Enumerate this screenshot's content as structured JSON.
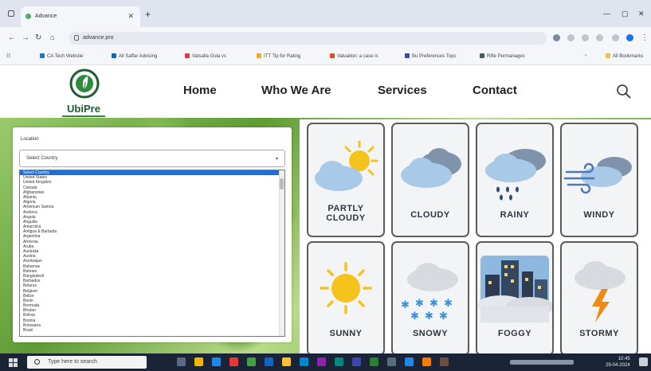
{
  "browser": {
    "tab_title": "Advance",
    "address": "advance.pro",
    "bookmarks": [
      "CA Tech Website",
      "All Saffar Advising",
      "Vatsalla Gola vs",
      "ITT Tip for Rating",
      "Valuation: a case is",
      "Bu Preferences Topc",
      "Rifle Permanages",
      "All Bookmarks"
    ]
  },
  "site": {
    "logo_text": "UbiPre",
    "nav": [
      "Home",
      "Who We Are",
      "Services",
      "Contact"
    ]
  },
  "country_panel": {
    "label": "Location",
    "select_placeholder": "Select Country",
    "options": [
      "Select Country",
      "United States",
      "United Kingdom",
      "Canada",
      "Afghanistan",
      "Albania",
      "Algeria",
      "American Samoa",
      "Andorra",
      "Angola",
      "Anguilla",
      "Antarctica",
      "Antigua & Barbuda",
      "Argentina",
      "Armenia",
      "Aruba",
      "Australia",
      "Austria",
      "Azerbaijan",
      "Bahamas",
      "Bahrain",
      "Bangladesh",
      "Barbados",
      "Belarus",
      "Belgium",
      "Belize",
      "Benin",
      "Bermuda",
      "Bhutan",
      "Bolivia",
      "Bosnia",
      "Botswana",
      "Brazil"
    ]
  },
  "weather_tiles": [
    {
      "label": "PARTLY CLOUDY",
      "icon": "partly-cloudy-icon"
    },
    {
      "label": "CLOUDY",
      "icon": "cloudy-icon"
    },
    {
      "label": "RAINY",
      "icon": "rainy-icon"
    },
    {
      "label": "WINDY",
      "icon": "windy-icon"
    },
    {
      "label": "SUNNY",
      "icon": "sunny-icon"
    },
    {
      "label": "SNOWY",
      "icon": "snowy-icon"
    },
    {
      "label": "FOGGY",
      "icon": "foggy-icon"
    },
    {
      "label": "STORMY",
      "icon": "stormy-icon"
    }
  ],
  "taskbar": {
    "search_placeholder": "Type here to search",
    "time": "10:45",
    "date": "29-04-2024"
  },
  "colors": {
    "brand_green": "#1f5c2e",
    "selection_blue": "#1e6fd9",
    "sun_yellow": "#f6c21c",
    "cloud_blue": "#9fc4e6"
  }
}
